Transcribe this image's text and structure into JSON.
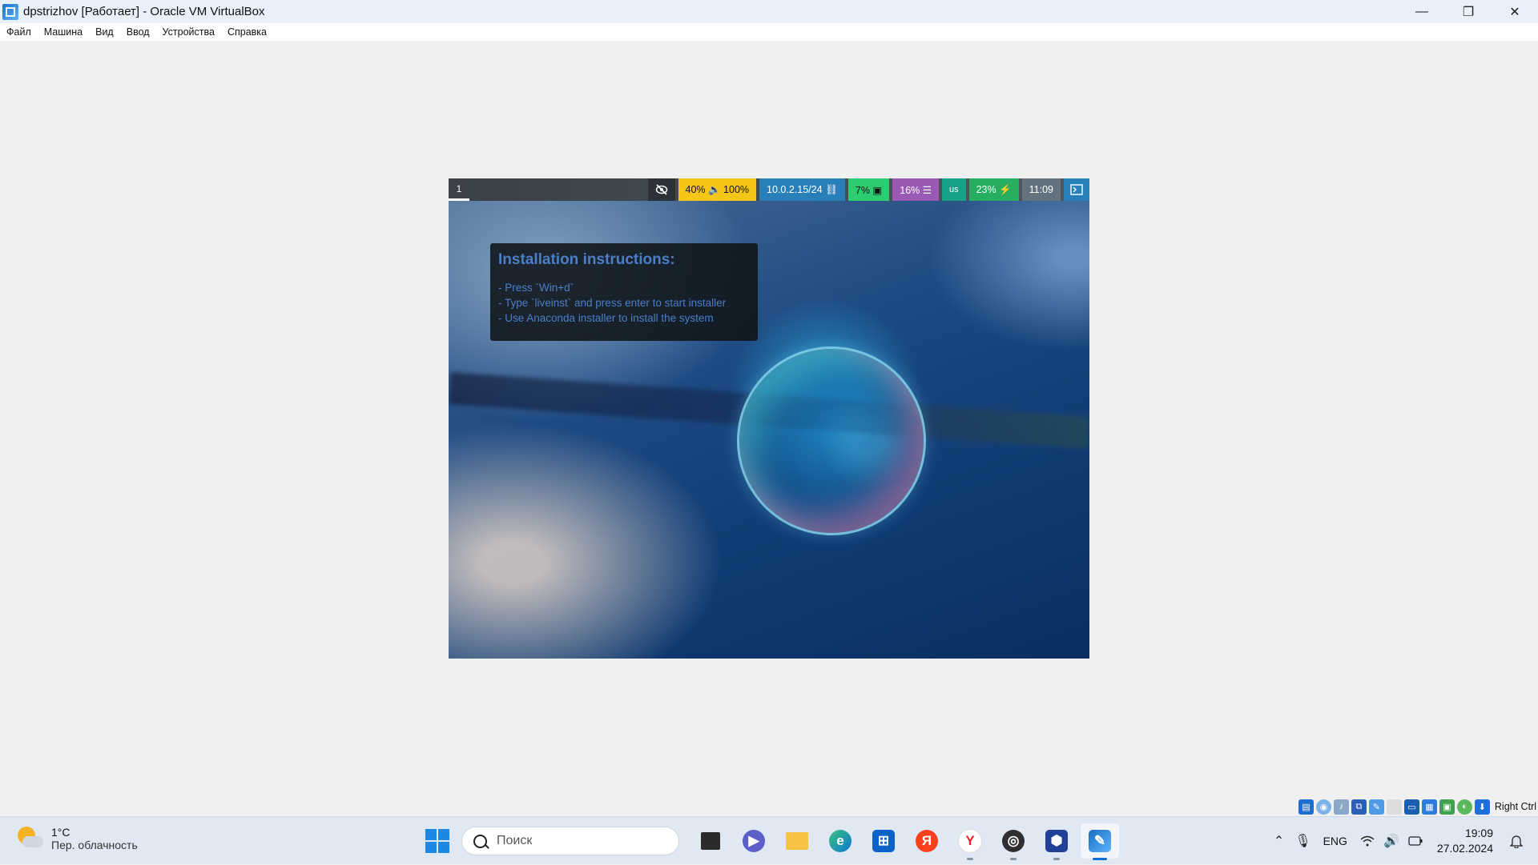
{
  "window": {
    "title": "dpstrizhov  [Работает] - Oracle VM VirtualBox",
    "controls": {
      "minimize": "—",
      "restore": "❐",
      "close": "✕"
    }
  },
  "menu": [
    "Файл",
    "Машина",
    "Вид",
    "Ввод",
    "Устройства",
    "Справка"
  ],
  "vm": {
    "waybar": {
      "workspace": "1",
      "idle_icon": "eye-slash-icon",
      "audio": "40% 🔈 100%",
      "network": "10.0.2.15/24 ⛓",
      "cpu": "7% ▣",
      "memory": "16% ☰",
      "keyboard": "us",
      "battery": "23% ⚡",
      "clock": "11:09",
      "tray_icon": "terminal-icon"
    },
    "instructions": {
      "title": "Installation instructions:",
      "lines": [
        "- Press `Win+d`",
        "- Type `liveinst` and press enter to start installer",
        "- Use Anaconda installer to install the system"
      ]
    }
  },
  "vbox_status": {
    "icons": [
      "hard-disk-icon",
      "optical-drive-icon",
      "audio-icon",
      "network-icon",
      "usb-icon",
      "shared-folders-icon",
      "display-icon",
      "recording-icon",
      "cpu-icon",
      "mouse-integration-icon",
      "keyboard-capture-icon"
    ],
    "host_key": "Right Ctrl"
  },
  "taskbar": {
    "weather": {
      "temp": "1°C",
      "desc": "Пер. облачность"
    },
    "search_placeholder": "Поиск",
    "apps": [
      "task-view-icon",
      "teams-chat-icon",
      "file-explorer-icon",
      "edge-icon",
      "store-icon",
      "yandex-icon",
      "yandex-browser-icon",
      "obs-icon",
      "virtualbox-icon",
      "virtualbox-vm-icon"
    ],
    "tray": {
      "language": "ENG",
      "time": "19:09",
      "date": "27.02.2024"
    }
  },
  "colors": {
    "waybar_audio": "#f5c518",
    "waybar_network": "#2980b9",
    "waybar_cpu": "#2ecc71",
    "waybar_memory": "#9b59b6",
    "waybar_keyboard": "#16a085",
    "waybar_battery": "#27ae60",
    "waybar_clock": "#64727d",
    "instruction_text": "#4a7fc7"
  }
}
